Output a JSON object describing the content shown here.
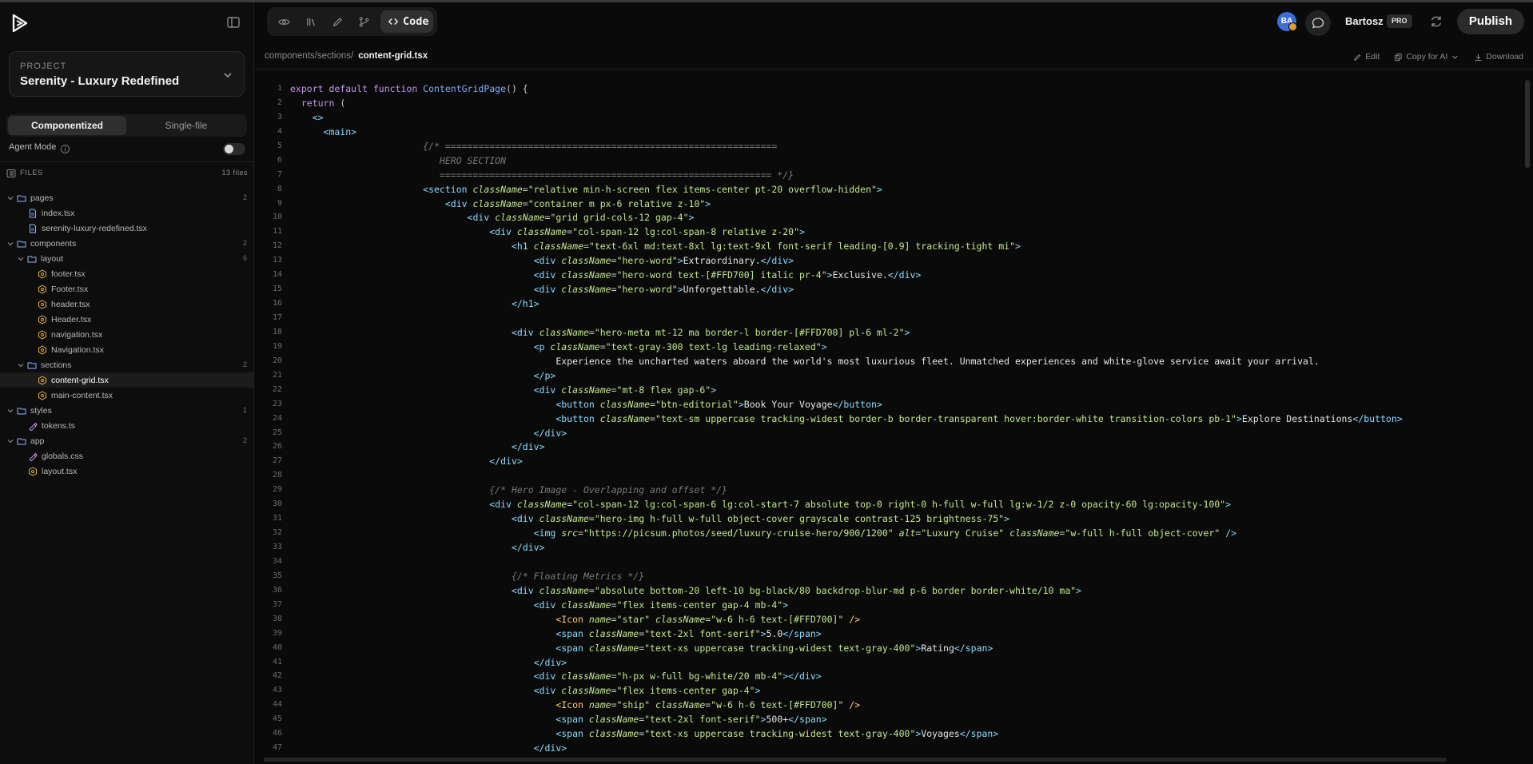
{
  "project": {
    "label": "PROJECT",
    "name": "Serenity - Luxury Redefined"
  },
  "modes": {
    "componentized": "Componentized",
    "single_file": "Single-file"
  },
  "agent_mode": {
    "label": "Agent Mode"
  },
  "files_panel": {
    "label": "FILES",
    "count": "13 files"
  },
  "tree": {
    "pages": {
      "label": "pages",
      "count": "2"
    },
    "index": {
      "label": "index.tsx"
    },
    "serenity": {
      "label": "serenity-luxury-redefined.tsx"
    },
    "components": {
      "label": "components",
      "count": "2"
    },
    "layout": {
      "label": "layout",
      "count": "6"
    },
    "footer_lc": {
      "label": "footer.tsx"
    },
    "footer_uc": {
      "label": "Footer.tsx"
    },
    "header_lc": {
      "label": "header.tsx"
    },
    "header_uc": {
      "label": "Header.tsx"
    },
    "navigation_lc": {
      "label": "navigation.tsx"
    },
    "navigation_uc": {
      "label": "Navigation.tsx"
    },
    "sections": {
      "label": "sections",
      "count": "2"
    },
    "content_grid": {
      "label": "content-grid.tsx"
    },
    "main_content": {
      "label": "main-content.tsx"
    },
    "styles": {
      "label": "styles",
      "count": "1"
    },
    "tokens": {
      "label": "tokens.ts"
    },
    "app": {
      "label": "app",
      "count": "2"
    },
    "globals": {
      "label": "globals.css"
    },
    "layout_file": {
      "label": "layout.tsx"
    }
  },
  "toolbar": {
    "code_label": "Code"
  },
  "user": {
    "initials": "BA",
    "name": "Bartosz",
    "plan": "PRO"
  },
  "publish_label": "Publish",
  "editor": {
    "path": "components/sections/",
    "file": "content-grid.tsx",
    "edit_label": "Edit",
    "copy_label": "Copy for AI",
    "download_label": "Download"
  },
  "code_lines": [
    [
      [
        "kw",
        "export default function "
      ],
      [
        "fn",
        "ContentGridPage"
      ],
      [
        "pn",
        "() {"
      ]
    ],
    [
      [
        "kw",
        "  return "
      ],
      [
        "pn",
        "("
      ]
    ],
    [
      [
        "tg",
        "    <>"
      ]
    ],
    [
      [
        "tg",
        "      <main>"
      ]
    ],
    [
      [
        "cm",
        "                        {/* ============================================================"
      ]
    ],
    [
      [
        "cm",
        "                           HERO SECTION"
      ]
    ],
    [
      [
        "cm",
        "                           ============================================================ */}"
      ]
    ],
    [
      [
        "tg",
        "                        <section "
      ],
      [
        "at",
        "className"
      ],
      [
        "pn",
        "="
      ],
      [
        "st",
        "\"relative min-h-screen flex items-center pt-20 overflow-hidden\""
      ],
      [
        "tg",
        ">"
      ]
    ],
    [
      [
        "tg",
        "                            <div "
      ],
      [
        "at",
        "className"
      ],
      [
        "pn",
        "="
      ],
      [
        "st",
        "\"container m px-6 relative z-10\""
      ],
      [
        "tg",
        ">"
      ]
    ],
    [
      [
        "tg",
        "                                <div "
      ],
      [
        "at",
        "className"
      ],
      [
        "pn",
        "="
      ],
      [
        "st",
        "\"grid grid-cols-12 gap-4\""
      ],
      [
        "tg",
        ">"
      ]
    ],
    [
      [
        "tg",
        "                                    <div "
      ],
      [
        "at",
        "className"
      ],
      [
        "pn",
        "="
      ],
      [
        "st",
        "\"col-span-12 lg:col-span-8 relative z-20\""
      ],
      [
        "tg",
        ">"
      ]
    ],
    [
      [
        "tg",
        "                                        <h1 "
      ],
      [
        "at",
        "className"
      ],
      [
        "pn",
        "="
      ],
      [
        "st",
        "\"text-6xl md:text-8xl lg:text-9xl font-serif leading-[0.9] tracking-tight mi\""
      ],
      [
        "tg",
        ">"
      ]
    ],
    [
      [
        "tg",
        "                                            <div "
      ],
      [
        "at",
        "className"
      ],
      [
        "pn",
        "="
      ],
      [
        "st",
        "\"hero-word\""
      ],
      [
        "tg",
        ">"
      ],
      [
        "tx",
        "Extraordinary."
      ],
      [
        "tg",
        "</div>"
      ]
    ],
    [
      [
        "tg",
        "                                            <div "
      ],
      [
        "at",
        "className"
      ],
      [
        "pn",
        "="
      ],
      [
        "st",
        "\"hero-word text-[#FFD700] italic pr-4\""
      ],
      [
        "tg",
        ">"
      ],
      [
        "tx",
        "Exclusive."
      ],
      [
        "tg",
        "</div>"
      ]
    ],
    [
      [
        "tg",
        "                                            <div "
      ],
      [
        "at",
        "className"
      ],
      [
        "pn",
        "="
      ],
      [
        "st",
        "\"hero-word\""
      ],
      [
        "tg",
        ">"
      ],
      [
        "tx",
        "Unforgettable."
      ],
      [
        "tg",
        "</div>"
      ]
    ],
    [
      [
        "tg",
        "                                        </h1>"
      ]
    ],
    [],
    [
      [
        "tg",
        "                                        <div "
      ],
      [
        "at",
        "className"
      ],
      [
        "pn",
        "="
      ],
      [
        "st",
        "\"hero-meta mt-12 ma border-l border-[#FFD700] pl-6 ml-2\""
      ],
      [
        "tg",
        ">"
      ]
    ],
    [
      [
        "tg",
        "                                            <p "
      ],
      [
        "at",
        "className"
      ],
      [
        "pn",
        "="
      ],
      [
        "st",
        "\"text-gray-300 text-lg leading-relaxed\""
      ],
      [
        "tg",
        ">"
      ]
    ],
    [
      [
        "tx",
        "                                                Experience the uncharted waters aboard the world's most luxurious fleet. Unmatched experiences and white-glove service await your arrival."
      ]
    ],
    [
      [
        "tg",
        "                                            </p>"
      ]
    ],
    [
      [
        "tg",
        "                                            <div "
      ],
      [
        "at",
        "className"
      ],
      [
        "pn",
        "="
      ],
      [
        "st",
        "\"mt-8 flex gap-6\""
      ],
      [
        "tg",
        ">"
      ]
    ],
    [
      [
        "tg",
        "                                                <button "
      ],
      [
        "at",
        "className"
      ],
      [
        "pn",
        "="
      ],
      [
        "st",
        "\"btn-editorial\""
      ],
      [
        "tg",
        ">"
      ],
      [
        "tx",
        "Book Your Voyage"
      ],
      [
        "tg",
        "</button>"
      ]
    ],
    [
      [
        "tg",
        "                                                <button "
      ],
      [
        "at",
        "className"
      ],
      [
        "pn",
        "="
      ],
      [
        "st",
        "\"text-sm uppercase tracking-widest border-b border-transparent hover:border-white transition-colors pb-1\""
      ],
      [
        "tg",
        ">"
      ],
      [
        "tx",
        "Explore Destinations"
      ],
      [
        "tg",
        "</button>"
      ]
    ],
    [
      [
        "tg",
        "                                            </div>"
      ]
    ],
    [
      [
        "tg",
        "                                        </div>"
      ]
    ],
    [
      [
        "tg",
        "                                    </div>"
      ]
    ],
    [],
    [
      [
        "cm",
        "                                    {/* Hero Image - Overlapping and offset */}"
      ]
    ],
    [
      [
        "tg",
        "                                    <div "
      ],
      [
        "at",
        "className"
      ],
      [
        "pn",
        "="
      ],
      [
        "st",
        "\"col-span-12 lg:col-span-6 lg:col-start-7 absolute top-0 right-0 h-full w-full lg:w-1/2 z-0 opacity-60 lg:opacity-100\""
      ],
      [
        "tg",
        ">"
      ]
    ],
    [
      [
        "tg",
        "                                        <div "
      ],
      [
        "at",
        "className"
      ],
      [
        "pn",
        "="
      ],
      [
        "st",
        "\"hero-img h-full w-full object-cover grayscale contrast-125 brightness-75\""
      ],
      [
        "tg",
        ">"
      ]
    ],
    [
      [
        "tg",
        "                                            <img "
      ],
      [
        "at",
        "src"
      ],
      [
        "pn",
        "="
      ],
      [
        "st",
        "\"https://picsum.photos/seed/luxury-cruise-hero/900/1200\" "
      ],
      [
        "at",
        "alt"
      ],
      [
        "pn",
        "="
      ],
      [
        "st",
        "\"Luxury Cruise\" "
      ],
      [
        "at",
        "className"
      ],
      [
        "pn",
        "="
      ],
      [
        "st",
        "\"w-full h-full object-cover\""
      ],
      [
        "tg",
        " />"
      ]
    ],
    [
      [
        "tg",
        "                                        </div>"
      ]
    ],
    [],
    [
      [
        "cm",
        "                                        {/* Floating Metrics */}"
      ]
    ],
    [
      [
        "tg",
        "                                        <div "
      ],
      [
        "at",
        "className"
      ],
      [
        "pn",
        "="
      ],
      [
        "st",
        "\"absolute bottom-20 left-10 bg-black/80 backdrop-blur-md p-6 border border-white/10 ma\""
      ],
      [
        "tg",
        ">"
      ]
    ],
    [
      [
        "tg",
        "                                            <div "
      ],
      [
        "at",
        "className"
      ],
      [
        "pn",
        "="
      ],
      [
        "st",
        "\"flex items-center gap-4 mb-4\""
      ],
      [
        "tg",
        ">"
      ]
    ],
    [
      [
        "br",
        "                                                <Icon "
      ],
      [
        "at",
        "name"
      ],
      [
        "pn",
        "="
      ],
      [
        "st",
        "\"star\" "
      ],
      [
        "at",
        "className"
      ],
      [
        "pn",
        "="
      ],
      [
        "st",
        "\"w-6 h-6 text-[#FFD700]\""
      ],
      [
        "br",
        " />"
      ]
    ],
    [
      [
        "tg",
        "                                                <span "
      ],
      [
        "at",
        "className"
      ],
      [
        "pn",
        "="
      ],
      [
        "st",
        "\"text-2xl font-serif\""
      ],
      [
        "tg",
        ">"
      ],
      [
        "tx",
        "5.0"
      ],
      [
        "tg",
        "</span>"
      ]
    ],
    [
      [
        "tg",
        "                                                <span "
      ],
      [
        "at",
        "className"
      ],
      [
        "pn",
        "="
      ],
      [
        "st",
        "\"text-xs uppercase tracking-widest text-gray-400\""
      ],
      [
        "tg",
        ">"
      ],
      [
        "tx",
        "Rating"
      ],
      [
        "tg",
        "</span>"
      ]
    ],
    [
      [
        "tg",
        "                                            </div>"
      ]
    ],
    [
      [
        "tg",
        "                                            <div "
      ],
      [
        "at",
        "className"
      ],
      [
        "pn",
        "="
      ],
      [
        "st",
        "\"h-px w-full bg-white/20 mb-4\""
      ],
      [
        "tg",
        "></div>"
      ]
    ],
    [
      [
        "tg",
        "                                            <div "
      ],
      [
        "at",
        "className"
      ],
      [
        "pn",
        "="
      ],
      [
        "st",
        "\"flex items-center gap-4\""
      ],
      [
        "tg",
        ">"
      ]
    ],
    [
      [
        "br",
        "                                                <Icon "
      ],
      [
        "at",
        "name"
      ],
      [
        "pn",
        "="
      ],
      [
        "st",
        "\"ship\" "
      ],
      [
        "at",
        "className"
      ],
      [
        "pn",
        "="
      ],
      [
        "st",
        "\"w-6 h-6 text-[#FFD700]\""
      ],
      [
        "br",
        " />"
      ]
    ],
    [
      [
        "tg",
        "                                                <span "
      ],
      [
        "at",
        "className"
      ],
      [
        "pn",
        "="
      ],
      [
        "st",
        "\"text-2xl font-serif\""
      ],
      [
        "tg",
        ">"
      ],
      [
        "tx",
        "500+"
      ],
      [
        "tg",
        "</span>"
      ]
    ],
    [
      [
        "tg",
        "                                                <span "
      ],
      [
        "at",
        "className"
      ],
      [
        "pn",
        "="
      ],
      [
        "st",
        "\"text-xs uppercase tracking-widest text-gray-400\""
      ],
      [
        "tg",
        ">"
      ],
      [
        "tx",
        "Voyages"
      ],
      [
        "tg",
        "</span>"
      ]
    ],
    [
      [
        "tg",
        "                                            </div>"
      ]
    ]
  ]
}
